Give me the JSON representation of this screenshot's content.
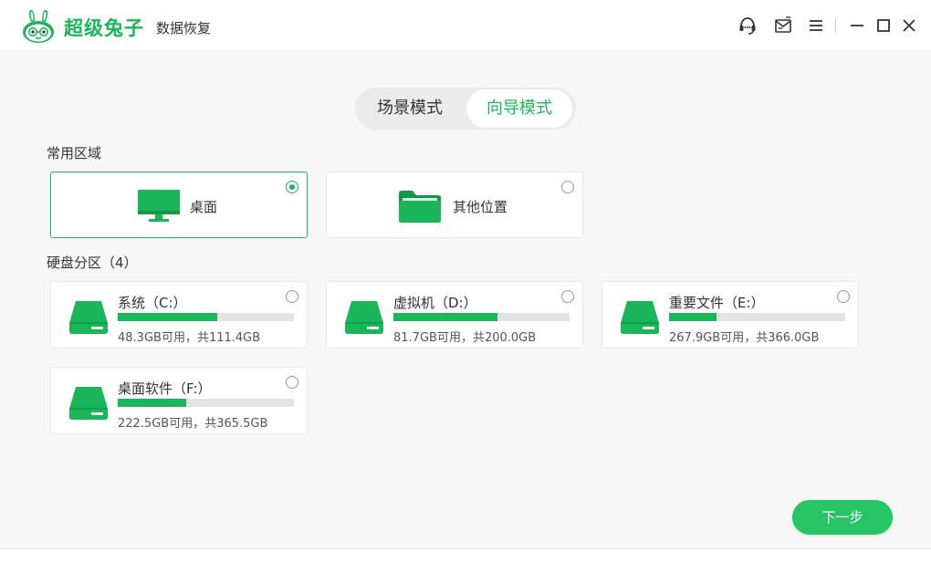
{
  "app": {
    "name": "超级兔子",
    "subtitle": "数据恢复"
  },
  "modes": [
    {
      "label": "场景模式",
      "active": false
    },
    {
      "label": "向导模式",
      "active": true
    }
  ],
  "common_area": {
    "title": "常用区域",
    "items": [
      {
        "label": "桌面",
        "icon": "monitor-icon",
        "selected": true
      },
      {
        "label": "其他位置",
        "icon": "folder-icon",
        "selected": false
      }
    ]
  },
  "partitions": {
    "title": "硬盘分区（4）",
    "drives": [
      {
        "name": "系统（C:）",
        "free_text": "48.3GB可用，共111.4GB",
        "used_fraction": 0.566,
        "selected": false
      },
      {
        "name": "虚拟机（D:）",
        "free_text": "81.7GB可用，共200.0GB",
        "used_fraction": 0.592,
        "selected": false
      },
      {
        "name": "重要文件（E:）",
        "free_text": "267.9GB可用，共366.0GB",
        "used_fraction": 0.268,
        "selected": false
      },
      {
        "name": "桌面软件（F:）",
        "free_text": "222.5GB可用，共365.5GB",
        "used_fraction": 0.391,
        "selected": false
      }
    ]
  },
  "buttons": {
    "next": "下一步"
  },
  "colors": {
    "brand": "#1bb65a",
    "accent_button": "#27c465"
  },
  "window_controls": [
    "support-icon",
    "feedback-icon",
    "menu-icon",
    "minimize-icon",
    "maximize-icon",
    "close-icon"
  ]
}
